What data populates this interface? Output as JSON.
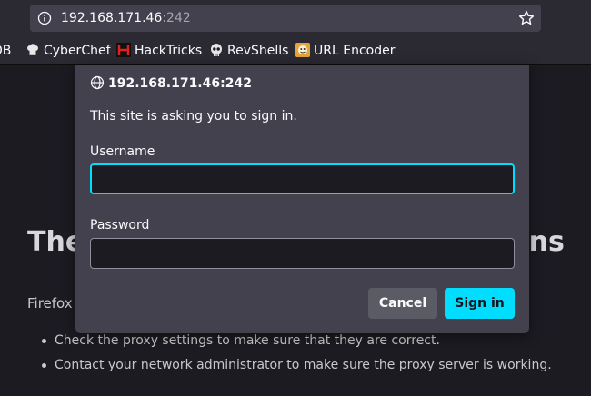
{
  "browser": {
    "url_host": "192.168.171.46",
    "url_port": ":242"
  },
  "bookmarks": [
    {
      "label": "DB",
      "icon": "partial-icon"
    },
    {
      "label": "CyberChef",
      "icon": "chef-hat-icon"
    },
    {
      "label": "HackTricks",
      "icon": "hacktricks-icon"
    },
    {
      "label": "RevShells",
      "icon": "skull-icon"
    },
    {
      "label": "URL Encoder",
      "icon": "url-encoder-icon"
    }
  ],
  "page": {
    "heading_left": "The",
    "heading_right": "ons",
    "description": "Firefox",
    "bullets": [
      "Check the proxy settings to make sure that they are correct.",
      "Contact your network administrator to make sure the proxy server is working."
    ]
  },
  "dialog": {
    "origin": "192.168.171.46:242",
    "message": "This site is asking you to sign in.",
    "username_label": "Username",
    "username_value": "",
    "password_label": "Password",
    "password_value": "",
    "cancel_label": "Cancel",
    "signin_label": "Sign in"
  },
  "colors": {
    "accent": "#00ddff",
    "dialog_bg": "#42414d",
    "page_bg": "#1c1b22"
  }
}
